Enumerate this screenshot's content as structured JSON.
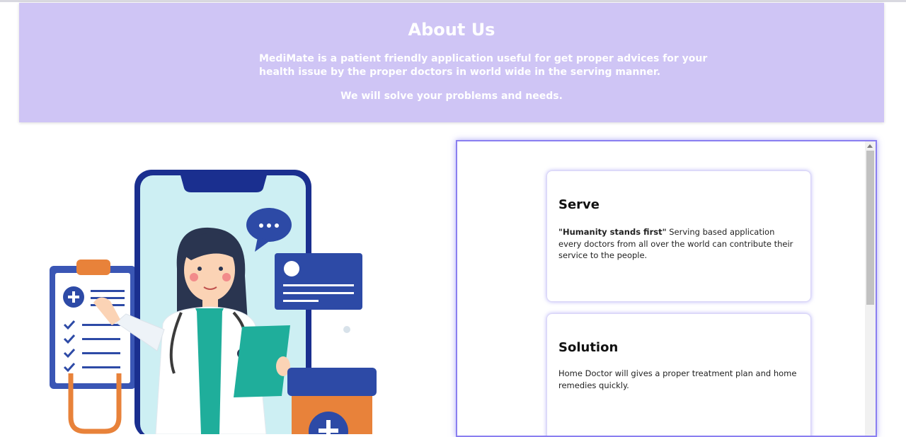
{
  "about": {
    "title": "About Us",
    "description": "MediMate is a patient friendly application useful for get proper advices for your health issue by the proper doctors in world wide in the serving manner.",
    "tagline": "We will solve your problems and needs."
  },
  "illustration": {
    "icon": "doctor-on-phone-illustration",
    "chat_dots": "•••"
  },
  "cards": [
    {
      "title": "Serve",
      "quote": "\"Humanity stands first\"",
      "text": " Serving based application every doctors from all over the world can contribute their service to the people."
    },
    {
      "title": "Solution",
      "text": "Home Doctor will gives a proper treatment plan and home remedies quickly."
    }
  ],
  "colors": {
    "about_bg": "#cfc5f5",
    "panel_border": "#8a7ff0",
    "phone": "#1a2f8f",
    "coat_green": "#1fae9b",
    "orange": "#e8823a"
  }
}
